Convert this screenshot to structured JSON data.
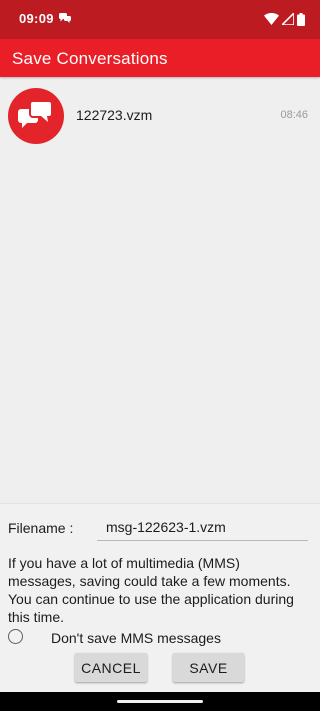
{
  "status_bar": {
    "time": "09:09",
    "icons": [
      "chat-notification-icon",
      "wifi-icon",
      "cell-signal-icon",
      "battery-icon"
    ]
  },
  "app_bar": {
    "title": "Save Conversations"
  },
  "files": [
    {
      "icon": "chat-bubbles-icon",
      "name": "122723.vzm",
      "time": "08:46"
    }
  ],
  "form": {
    "filename_label": "Filename :",
    "filename_value": "msg-122623-1.vzm",
    "info_text": "If you have a lot of multimedia (MMS) messages, saving could take a few moments. You can continue to use the application during this time.",
    "dont_save_mms_label": "Don't save MMS messages",
    "dont_save_mms_checked": false
  },
  "buttons": {
    "cancel_label": "CANCEL",
    "save_label": "SAVE"
  },
  "colors": {
    "status_bar": "#bd1b22",
    "app_bar": "#ea1e27",
    "file_icon": "#e3242b",
    "background": "#efefef"
  }
}
